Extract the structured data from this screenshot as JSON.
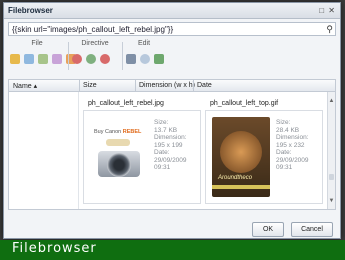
{
  "window": {
    "title": "Filebrowser",
    "controls": "□ ✕"
  },
  "pathbar": {
    "value": "{{skin url=\"images/ph_callout_left_rebel.jpg\"}}",
    "search_icon": "search-icon"
  },
  "toolbar": {
    "groups": [
      {
        "label": "File",
        "icons": [
          "folder-icon",
          "upload-icon",
          "copy-icon",
          "cut-icon",
          "delete-icon"
        ]
      },
      {
        "label": "Directive",
        "icons": [
          "prev-icon",
          "refresh-icon",
          "next-icon"
        ]
      },
      {
        "label": "Edit",
        "icons": [
          "view-icon",
          "zoom-icon",
          "add-icon"
        ]
      }
    ]
  },
  "list": {
    "columns": {
      "name": "Name ▴",
      "size": "Size",
      "dimension": "Dimension (w x h)",
      "date": "Date"
    }
  },
  "files": [
    {
      "name": "ph_callout_left_rebel.jpg",
      "size_label": "Size:",
      "size": "13.7 KB",
      "dim_label": "Dimension:",
      "dimension": "195 x 199",
      "date_label": "Date:",
      "date": "29/09/2009 09:31",
      "image_text": "Buy Canon",
      "image_text2": "REBEL"
    },
    {
      "name": "ph_callout_left_top.gif",
      "size_label": "Size:",
      "size": "28.4 KB",
      "dim_label": "Dimension:",
      "dimension": "195 x 232",
      "date_label": "Date:",
      "date": "29/09/2009 09:31",
      "image_text": "Aroundtheco"
    }
  ],
  "buttons": {
    "ok": "OK",
    "cancel": "Cancel"
  },
  "footer": {
    "text": "Filebrowser",
    "color": "#0f6e10"
  }
}
